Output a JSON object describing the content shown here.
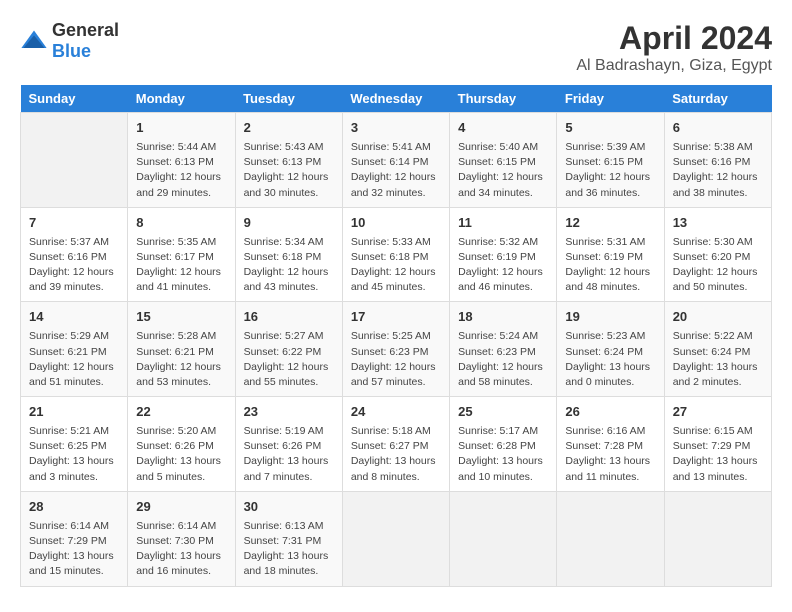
{
  "logo": {
    "general": "General",
    "blue": "Blue"
  },
  "title": "April 2024",
  "subtitle": "Al Badrashayn, Giza, Egypt",
  "days_header": [
    "Sunday",
    "Monday",
    "Tuesday",
    "Wednesday",
    "Thursday",
    "Friday",
    "Saturday"
  ],
  "weeks": [
    [
      {
        "day": "",
        "info": ""
      },
      {
        "day": "1",
        "info": "Sunrise: 5:44 AM\nSunset: 6:13 PM\nDaylight: 12 hours\nand 29 minutes."
      },
      {
        "day": "2",
        "info": "Sunrise: 5:43 AM\nSunset: 6:13 PM\nDaylight: 12 hours\nand 30 minutes."
      },
      {
        "day": "3",
        "info": "Sunrise: 5:41 AM\nSunset: 6:14 PM\nDaylight: 12 hours\nand 32 minutes."
      },
      {
        "day": "4",
        "info": "Sunrise: 5:40 AM\nSunset: 6:15 PM\nDaylight: 12 hours\nand 34 minutes."
      },
      {
        "day": "5",
        "info": "Sunrise: 5:39 AM\nSunset: 6:15 PM\nDaylight: 12 hours\nand 36 minutes."
      },
      {
        "day": "6",
        "info": "Sunrise: 5:38 AM\nSunset: 6:16 PM\nDaylight: 12 hours\nand 38 minutes."
      }
    ],
    [
      {
        "day": "7",
        "info": "Sunrise: 5:37 AM\nSunset: 6:16 PM\nDaylight: 12 hours\nand 39 minutes."
      },
      {
        "day": "8",
        "info": "Sunrise: 5:35 AM\nSunset: 6:17 PM\nDaylight: 12 hours\nand 41 minutes."
      },
      {
        "day": "9",
        "info": "Sunrise: 5:34 AM\nSunset: 6:18 PM\nDaylight: 12 hours\nand 43 minutes."
      },
      {
        "day": "10",
        "info": "Sunrise: 5:33 AM\nSunset: 6:18 PM\nDaylight: 12 hours\nand 45 minutes."
      },
      {
        "day": "11",
        "info": "Sunrise: 5:32 AM\nSunset: 6:19 PM\nDaylight: 12 hours\nand 46 minutes."
      },
      {
        "day": "12",
        "info": "Sunrise: 5:31 AM\nSunset: 6:19 PM\nDaylight: 12 hours\nand 48 minutes."
      },
      {
        "day": "13",
        "info": "Sunrise: 5:30 AM\nSunset: 6:20 PM\nDaylight: 12 hours\nand 50 minutes."
      }
    ],
    [
      {
        "day": "14",
        "info": "Sunrise: 5:29 AM\nSunset: 6:21 PM\nDaylight: 12 hours\nand 51 minutes."
      },
      {
        "day": "15",
        "info": "Sunrise: 5:28 AM\nSunset: 6:21 PM\nDaylight: 12 hours\nand 53 minutes."
      },
      {
        "day": "16",
        "info": "Sunrise: 5:27 AM\nSunset: 6:22 PM\nDaylight: 12 hours\nand 55 minutes."
      },
      {
        "day": "17",
        "info": "Sunrise: 5:25 AM\nSunset: 6:23 PM\nDaylight: 12 hours\nand 57 minutes."
      },
      {
        "day": "18",
        "info": "Sunrise: 5:24 AM\nSunset: 6:23 PM\nDaylight: 12 hours\nand 58 minutes."
      },
      {
        "day": "19",
        "info": "Sunrise: 5:23 AM\nSunset: 6:24 PM\nDaylight: 13 hours\nand 0 minutes."
      },
      {
        "day": "20",
        "info": "Sunrise: 5:22 AM\nSunset: 6:24 PM\nDaylight: 13 hours\nand 2 minutes."
      }
    ],
    [
      {
        "day": "21",
        "info": "Sunrise: 5:21 AM\nSunset: 6:25 PM\nDaylight: 13 hours\nand 3 minutes."
      },
      {
        "day": "22",
        "info": "Sunrise: 5:20 AM\nSunset: 6:26 PM\nDaylight: 13 hours\nand 5 minutes."
      },
      {
        "day": "23",
        "info": "Sunrise: 5:19 AM\nSunset: 6:26 PM\nDaylight: 13 hours\nand 7 minutes."
      },
      {
        "day": "24",
        "info": "Sunrise: 5:18 AM\nSunset: 6:27 PM\nDaylight: 13 hours\nand 8 minutes."
      },
      {
        "day": "25",
        "info": "Sunrise: 5:17 AM\nSunset: 6:28 PM\nDaylight: 13 hours\nand 10 minutes."
      },
      {
        "day": "26",
        "info": "Sunrise: 6:16 AM\nSunset: 7:28 PM\nDaylight: 13 hours\nand 11 minutes."
      },
      {
        "day": "27",
        "info": "Sunrise: 6:15 AM\nSunset: 7:29 PM\nDaylight: 13 hours\nand 13 minutes."
      }
    ],
    [
      {
        "day": "28",
        "info": "Sunrise: 6:14 AM\nSunset: 7:29 PM\nDaylight: 13 hours\nand 15 minutes."
      },
      {
        "day": "29",
        "info": "Sunrise: 6:14 AM\nSunset: 7:30 PM\nDaylight: 13 hours\nand 16 minutes."
      },
      {
        "day": "30",
        "info": "Sunrise: 6:13 AM\nSunset: 7:31 PM\nDaylight: 13 hours\nand 18 minutes."
      },
      {
        "day": "",
        "info": ""
      },
      {
        "day": "",
        "info": ""
      },
      {
        "day": "",
        "info": ""
      },
      {
        "day": "",
        "info": ""
      }
    ]
  ]
}
